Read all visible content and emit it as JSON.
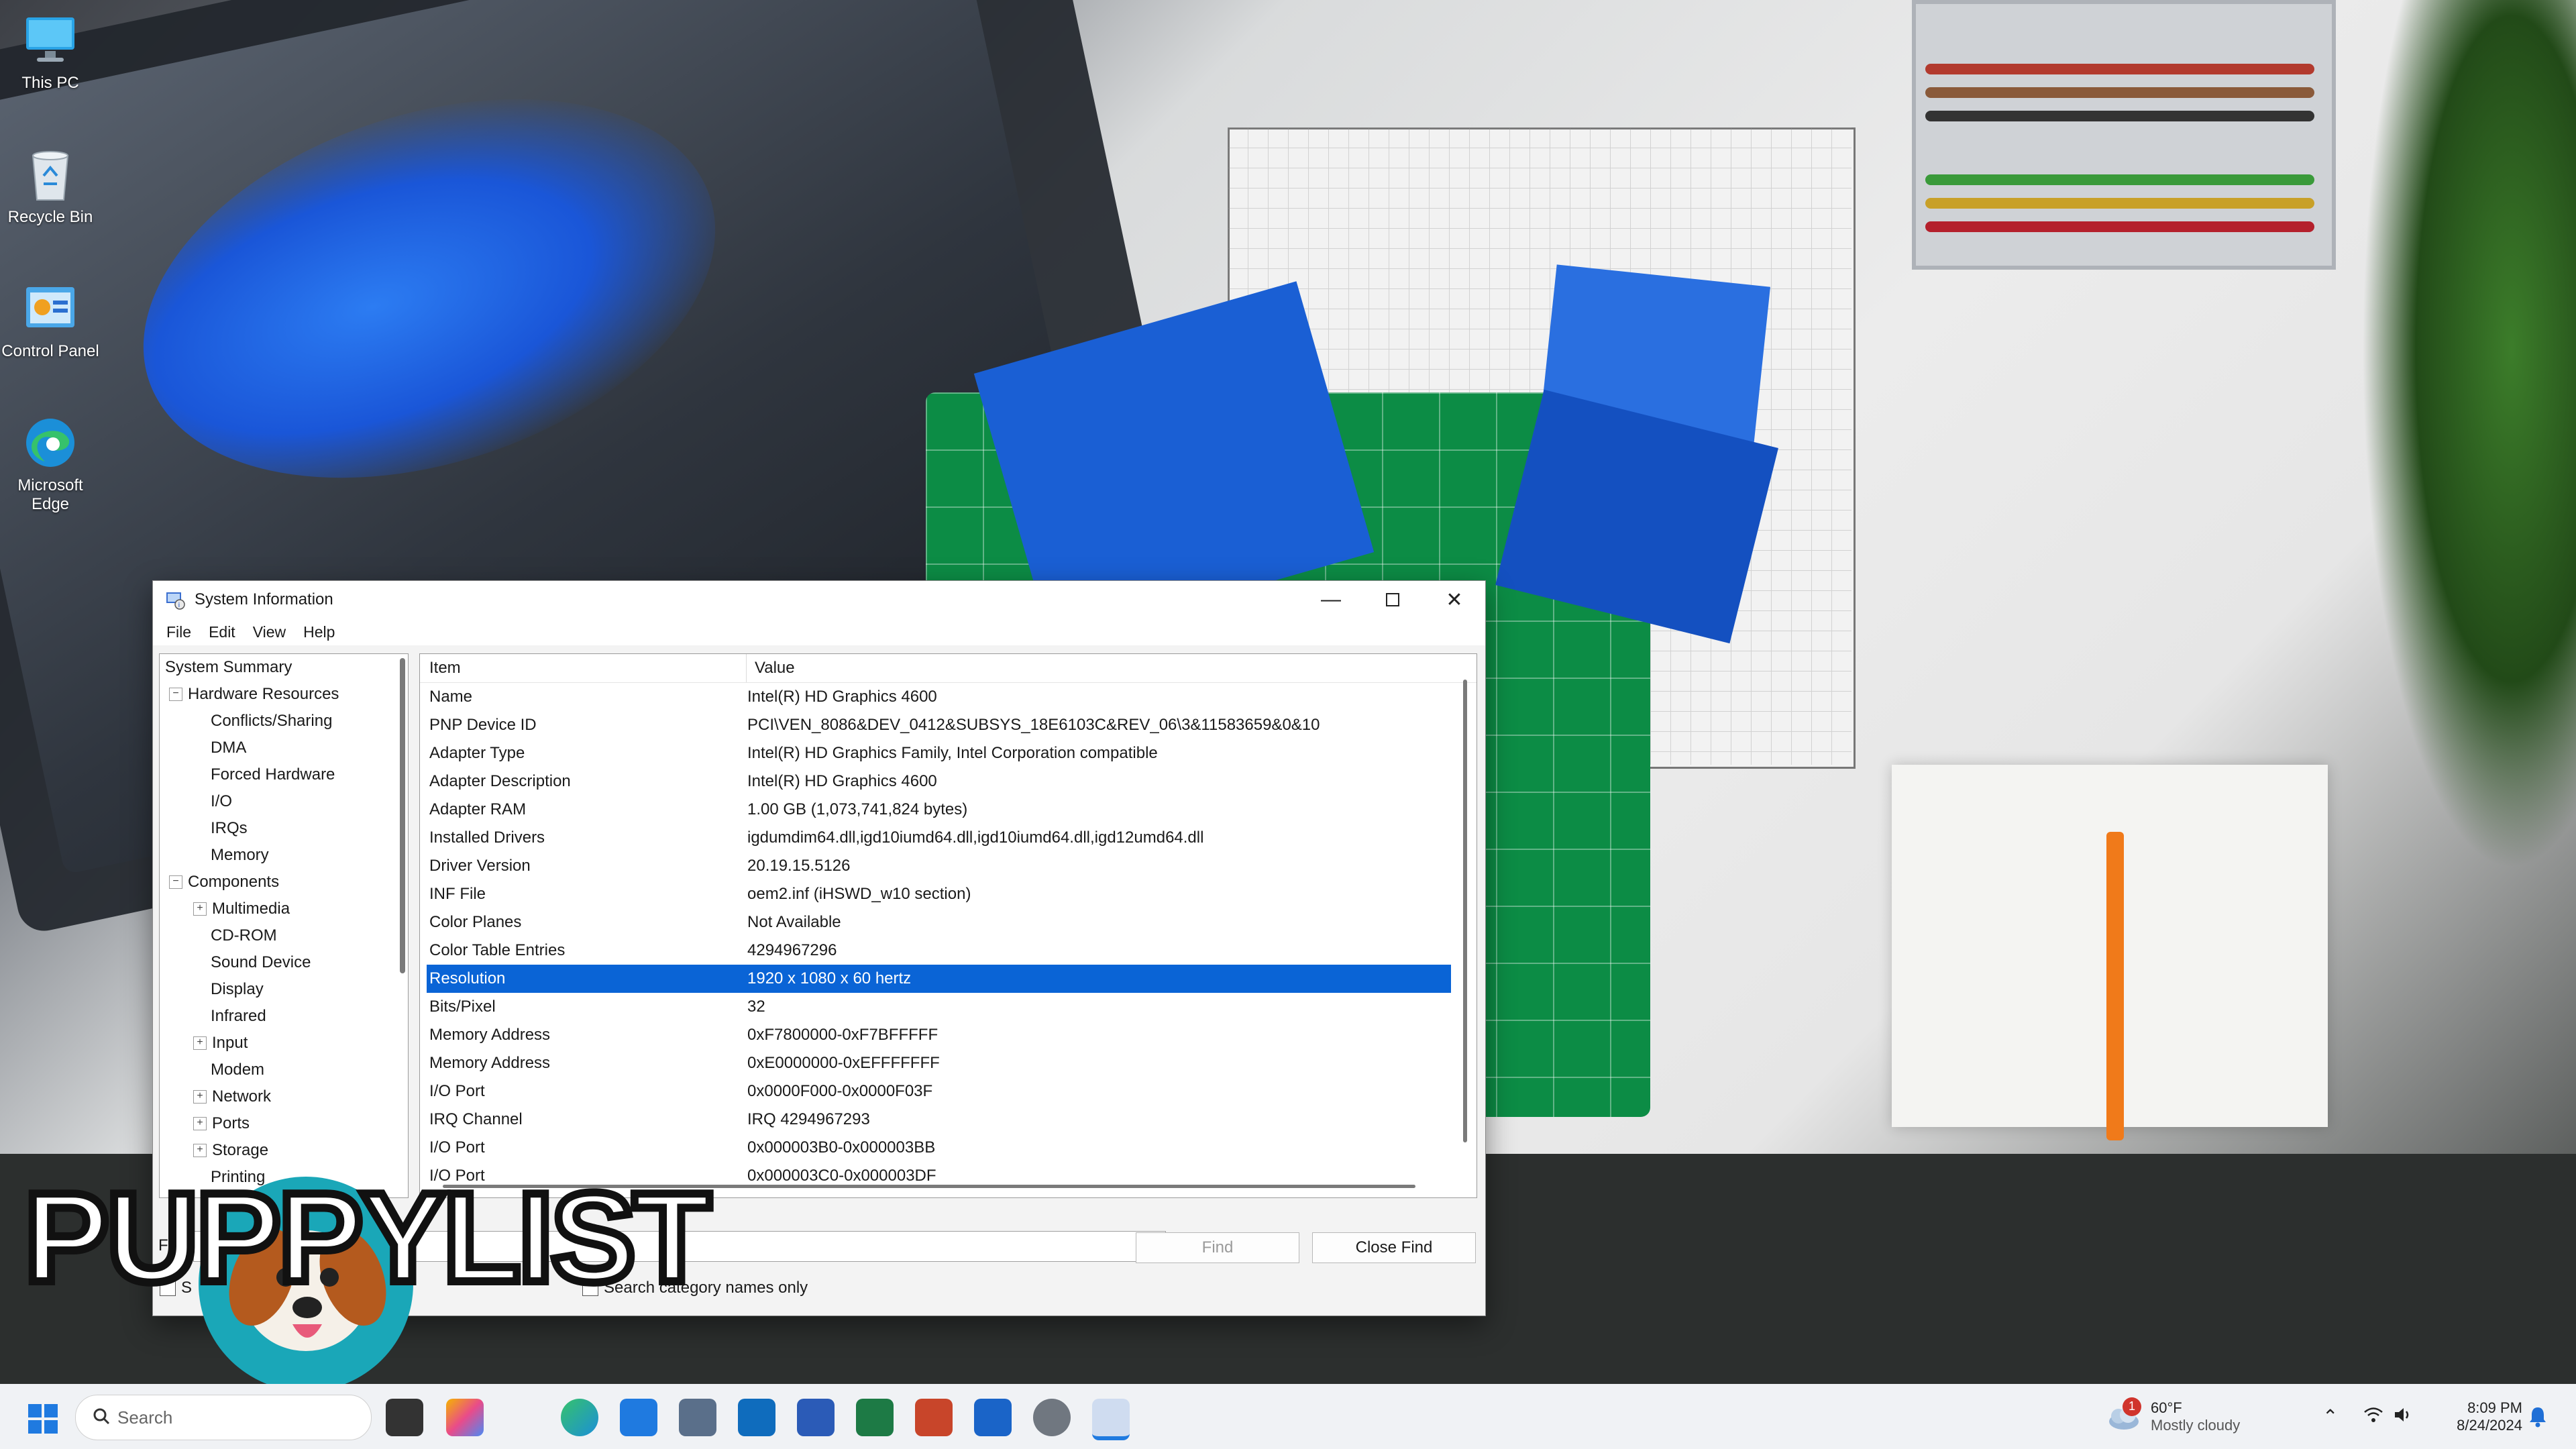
{
  "desktop": {
    "icons": [
      {
        "label": "This PC"
      },
      {
        "label": "Recycle Bin"
      },
      {
        "label": "Control Panel"
      },
      {
        "label": "Microsoft Edge"
      }
    ]
  },
  "window": {
    "title": "System Information",
    "menu": [
      "File",
      "Edit",
      "View",
      "Help"
    ],
    "tree": [
      {
        "label": "System Summary",
        "level": 0,
        "expander": ""
      },
      {
        "label": "Hardware Resources",
        "level": 1,
        "expander": "−"
      },
      {
        "label": "Conflicts/Sharing",
        "level": 2,
        "expander": ""
      },
      {
        "label": "DMA",
        "level": 2,
        "expander": ""
      },
      {
        "label": "Forced Hardware",
        "level": 2,
        "expander": ""
      },
      {
        "label": "I/O",
        "level": 2,
        "expander": ""
      },
      {
        "label": "IRQs",
        "level": 2,
        "expander": ""
      },
      {
        "label": "Memory",
        "level": 2,
        "expander": ""
      },
      {
        "label": "Components",
        "level": 1,
        "expander": "−"
      },
      {
        "label": "Multimedia",
        "level": 2,
        "expander": "+"
      },
      {
        "label": "CD-ROM",
        "level": 2,
        "expander": ""
      },
      {
        "label": "Sound Device",
        "level": 2,
        "expander": ""
      },
      {
        "label": "Display",
        "level": 2,
        "expander": ""
      },
      {
        "label": "Infrared",
        "level": 2,
        "expander": ""
      },
      {
        "label": "Input",
        "level": 2,
        "expander": "+"
      },
      {
        "label": "Modem",
        "level": 2,
        "expander": ""
      },
      {
        "label": "Network",
        "level": 2,
        "expander": "+"
      },
      {
        "label": "Ports",
        "level": 2,
        "expander": "+"
      },
      {
        "label": "Storage",
        "level": 2,
        "expander": "+"
      },
      {
        "label": "Printing",
        "level": 2,
        "expander": ""
      }
    ],
    "columns": {
      "item": "Item",
      "value": "Value"
    },
    "rows": [
      {
        "item": "Name",
        "value": "Intel(R) HD Graphics 4600"
      },
      {
        "item": "PNP Device ID",
        "value": "PCI\\VEN_8086&DEV_0412&SUBSYS_18E6103C&REV_06\\3&11583659&0&10"
      },
      {
        "item": "Adapter Type",
        "value": "Intel(R) HD Graphics Family, Intel Corporation compatible"
      },
      {
        "item": "Adapter Description",
        "value": "Intel(R) HD Graphics 4600"
      },
      {
        "item": "Adapter RAM",
        "value": "1.00 GB (1,073,741,824 bytes)"
      },
      {
        "item": "Installed Drivers",
        "value": "igdumdim64.dll,igd10iumd64.dll,igd10iumd64.dll,igd12umd64.dll"
      },
      {
        "item": "Driver Version",
        "value": "20.19.15.5126"
      },
      {
        "item": "INF File",
        "value": "oem2.inf (iHSWD_w10 section)"
      },
      {
        "item": "Color Planes",
        "value": "Not Available"
      },
      {
        "item": "Color Table Entries",
        "value": "4294967296"
      },
      {
        "item": "Resolution",
        "value": "1920 x 1080 x 60 hertz",
        "selected": true
      },
      {
        "item": "Bits/Pixel",
        "value": "32"
      },
      {
        "item": "Memory Address",
        "value": "0xF7800000-0xF7BFFFFF"
      },
      {
        "item": "Memory Address",
        "value": "0xE0000000-0xEFFFFFFF"
      },
      {
        "item": "I/O Port",
        "value": "0x0000F000-0x0000F03F"
      },
      {
        "item": "IRQ Channel",
        "value": "IRQ 4294967293"
      },
      {
        "item": "I/O Port",
        "value": "0x000003B0-0x000003BB"
      },
      {
        "item": "I/O Port",
        "value": "0x000003C0-0x000003DF"
      }
    ],
    "find": {
      "label": "Find",
      "value": "",
      "find_button": "Find",
      "close_button": "Close Find",
      "search_selected_label": "S",
      "search_category_label": "Search category names only"
    }
  },
  "taskbar": {
    "search_placeholder": "Search",
    "weather_temp": "60°F",
    "weather_desc": "Mostly cloudy",
    "weather_badge": "1",
    "time": "8:09 PM",
    "date": "8/24/2024"
  },
  "overlay": {
    "brand": "PUPPYLIST"
  },
  "colors": {
    "selection": "#0a64d6",
    "taskbar": "#f0f2f5",
    "mat": "#0c8c45",
    "accent_blue": "#1a5fd4"
  }
}
